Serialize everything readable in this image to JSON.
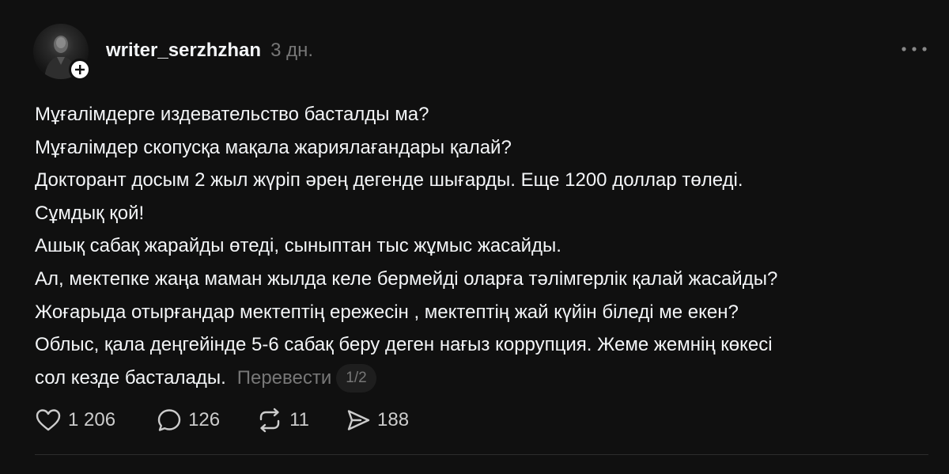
{
  "post": {
    "username": "writer_serzhzhan",
    "time": "3 дн.",
    "lines": [
      "Мұғалімдерге издевательство басталды ма?",
      "Мұғалімдер скопусқа мақала жариялағандары қалай?",
      "Докторант досым 2 жыл жүріп әрең дегенде шығарды. Еще 1200 доллар төледі.",
      "Сұмдық қой!",
      "Ашық сабақ жарайды өтеді, сыныптан тыс жұмыс жасайды.",
      "Ал, мектепке жаңа маман жылда келе бермейді оларға тәлімгерлік қалай жасайды?",
      "Жоғарыда отырғандар мектептің ережесін , мектептің жай күйін біледі ме екен?",
      "Облыс, қала деңгейінде 5-6 сабақ беру деген нағыз коррупция. Жеме жемнің көкесі"
    ],
    "last_line": "сол кезде басталады.",
    "translate_label": "Перевести",
    "page_indicator": "1/2"
  },
  "actions": {
    "likes": "1 206",
    "comments": "126",
    "reposts": "11",
    "shares": "188"
  },
  "icons": {
    "avatar": "profile-photo",
    "follow": "plus-icon",
    "more": "more-horizontal-icon",
    "like": "heart-icon",
    "comment": "comment-bubble-icon",
    "repost": "repost-icon",
    "share": "send-icon"
  },
  "colors": {
    "background": "#101010",
    "text": "#f3f5f7",
    "muted": "#777777"
  }
}
